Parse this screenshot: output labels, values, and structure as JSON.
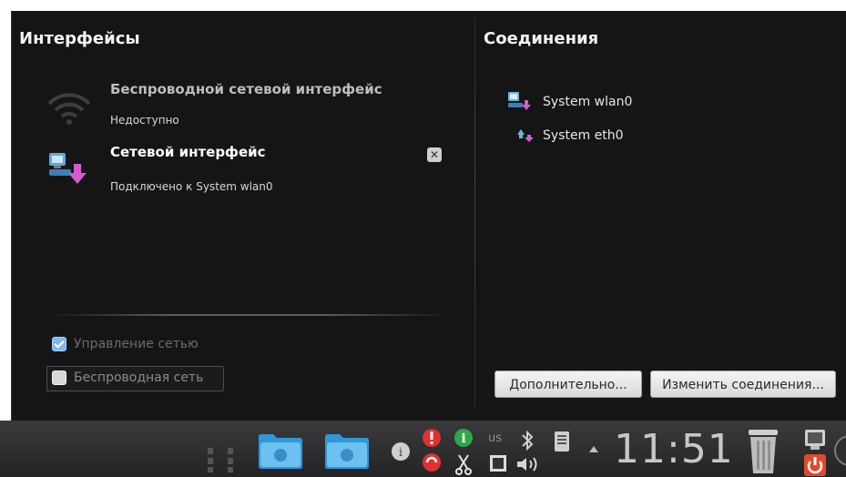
{
  "interfaces": {
    "heading": "Интерфейсы",
    "items": [
      {
        "title": "Беспроводной сетевой интерфейс",
        "status": "Недоступно",
        "icon": "wifi-icon"
      },
      {
        "title": "Сетевой интерфейс",
        "status": "Подключено к System wlan0",
        "icon": "network-interface-icon"
      }
    ],
    "options": [
      {
        "label": "Управление сетью",
        "checked": true
      },
      {
        "label": "Беспроводная сеть",
        "checked": false
      }
    ]
  },
  "connections": {
    "heading": "Соединения",
    "items": [
      {
        "label": "System wlan0",
        "icon": "wireless-connection-icon"
      },
      {
        "label": "System eth0",
        "icon": "wired-connection-icon"
      }
    ],
    "buttons": {
      "advanced": "Дополнительно...",
      "edit": "Изменить соединения..."
    }
  },
  "taskbar": {
    "keyboard_layout": "us",
    "clock": "11:51"
  },
  "colors": {
    "panel_bg": "#151516",
    "accent": "#7db8f0"
  }
}
